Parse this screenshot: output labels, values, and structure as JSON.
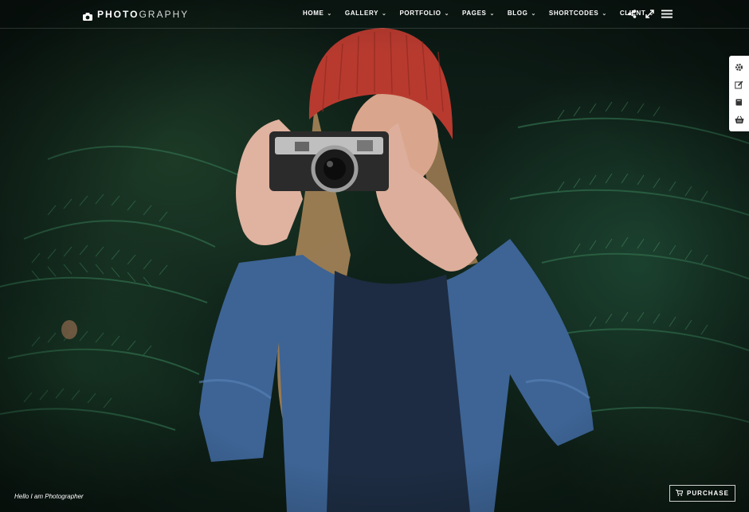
{
  "brand": {
    "logo_bold": "PHOTO",
    "logo_light": "GRAPHY",
    "logo_icon": "camera-icon"
  },
  "nav": {
    "items": [
      {
        "label": "HOME",
        "icon": "chevron-down-icon"
      },
      {
        "label": "GALLERY",
        "icon": "chevron-down-icon"
      },
      {
        "label": "PORTFOLIO",
        "icon": "chevron-down-icon"
      },
      {
        "label": "PAGES",
        "icon": "chevron-down-icon"
      },
      {
        "label": "BLOG",
        "icon": "chevron-down-icon"
      },
      {
        "label": "SHORTCODES",
        "icon": "chevron-down-icon"
      },
      {
        "label": "CLIENT",
        "icon": "chevron-down-icon"
      }
    ],
    "icons": [
      "share-icon",
      "fullscreen-icon",
      "menu-icon"
    ]
  },
  "side_panel": {
    "icons": [
      "gear-icon",
      "edit-icon",
      "book-icon",
      "basket-icon"
    ]
  },
  "footer": {
    "tagline": "Hello I am Photographer",
    "purchase_label": "PURCHASE",
    "purchase_icon": "cart-icon"
  },
  "colors": {
    "accent_panel": "#ffffff",
    "beanie": "#b83a2f",
    "jacket": "#3f679c",
    "foliage": "#1f4a36"
  }
}
